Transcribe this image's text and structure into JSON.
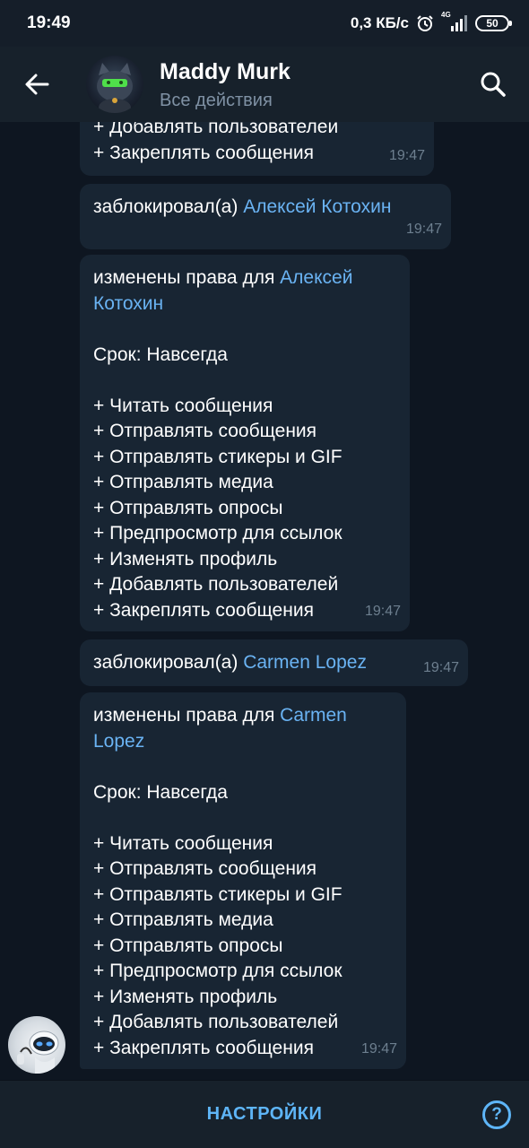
{
  "status_bar": {
    "time": "19:49",
    "speed": "0,3 КБ/с",
    "network": "4G",
    "battery": "50",
    "icons": [
      "alarm-icon",
      "signal-icon",
      "battery-icon"
    ]
  },
  "header": {
    "title": "Maddy Murk",
    "subtitle": "Все действия",
    "back_icon": "arrow-left-icon",
    "search_icon": "search-icon"
  },
  "messages": [
    {
      "lines": [
        "+ Добавлять пользователей",
        "+ Закреплять сообщения"
      ],
      "time": "19:47"
    },
    {
      "prefix": "заблокировал(а) ",
      "link": "Алексей Котохин",
      "time": "19:47"
    },
    {
      "prefix": "изменены права для ",
      "link_part1": "Алексей",
      "link_part2": "Котохин",
      "term": "Срок: Навсегда",
      "rights": [
        "+ Читать сообщения",
        "+ Отправлять сообщения",
        "+ Отправлять стикеры и GIF",
        "+ Отправлять медиа",
        "+ Отправлять опросы",
        "+ Предпросмотр для ссылок",
        "+ Изменять профиль",
        "+ Добавлять пользователей",
        "+ Закреплять сообщения"
      ],
      "time": "19:47"
    },
    {
      "prefix": "заблокировал(а) ",
      "link": "Carmen Lopez",
      "time": "19:47"
    },
    {
      "prefix": "изменены права для ",
      "link_part1": "Carmen",
      "link_part2": "Lopez",
      "term": "Срок: Навсегда",
      "rights": [
        "+ Читать сообщения",
        "+ Отправлять сообщения",
        "+ Отправлять стикеры и GIF",
        "+ Отправлять медиа",
        "+ Отправлять опросы",
        "+ Предпросмотр для ссылок",
        "+ Изменять профиль",
        "+ Добавлять пользователей",
        "+ Закреплять сообщения"
      ],
      "time": "19:47"
    }
  ],
  "bottom_bar": {
    "settings_label": "НАСТРОЙКИ",
    "help_label": "?"
  },
  "colors": {
    "background": "#0e1621",
    "bubble": "#182533",
    "link": "#6ab3f3",
    "accent": "#5eb5f7",
    "meta": "#6d7f8f"
  }
}
